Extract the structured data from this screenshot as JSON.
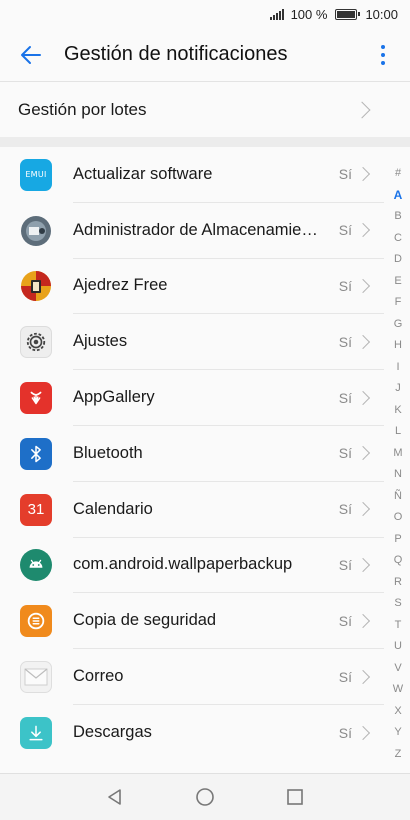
{
  "status": {
    "battery_text": "100 %",
    "time": "10:00"
  },
  "header": {
    "title": "Gestión de notificaciones",
    "back_icon": "arrow-back-icon",
    "menu_icon": "more-vertical-icon"
  },
  "batch": {
    "label": "Gestión por lotes"
  },
  "apps": [
    {
      "name": "Actualizar software",
      "value": "Sí",
      "icon": "emui-update-icon"
    },
    {
      "name": "Administrador de Almacenamie…",
      "value": "Sí",
      "icon": "storage-manager-icon"
    },
    {
      "name": "Ajedrez Free",
      "value": "Sí",
      "icon": "chess-icon"
    },
    {
      "name": "Ajustes",
      "value": "Sí",
      "icon": "settings-gear-icon"
    },
    {
      "name": "AppGallery",
      "value": "Sí",
      "icon": "huawei-appgallery-icon"
    },
    {
      "name": "Bluetooth",
      "value": "Sí",
      "icon": "bluetooth-icon"
    },
    {
      "name": "Calendario",
      "value": "Sí",
      "icon": "calendar-icon"
    },
    {
      "name": "com.android.wallpaperbackup",
      "value": "Sí",
      "icon": "android-icon"
    },
    {
      "name": "Copia de seguridad",
      "value": "Sí",
      "icon": "backup-icon"
    },
    {
      "name": "Correo",
      "value": "Sí",
      "icon": "mail-icon"
    },
    {
      "name": "Descargas",
      "value": "Sí",
      "icon": "download-icon"
    }
  ],
  "icon_texts": {
    "emui": "EMUI",
    "calendar_day": "31"
  },
  "alphabet": [
    "#",
    "A",
    "B",
    "C",
    "D",
    "E",
    "F",
    "G",
    "H",
    "I",
    "J",
    "K",
    "L",
    "M",
    "N",
    "Ñ",
    "O",
    "P",
    "Q",
    "R",
    "S",
    "T",
    "U",
    "V",
    "W",
    "X",
    "Y",
    "Z"
  ],
  "alphabet_active": "A",
  "colors": {
    "accent": "#1a73e8",
    "emui": "#17a8e3",
    "appgallery": "#e4322b",
    "bluetooth": "#1e6fc8",
    "calendar": "#e43d2b",
    "android": "#1e8a6e",
    "backup": "#f08a1c",
    "download": "#3cc3c8"
  }
}
